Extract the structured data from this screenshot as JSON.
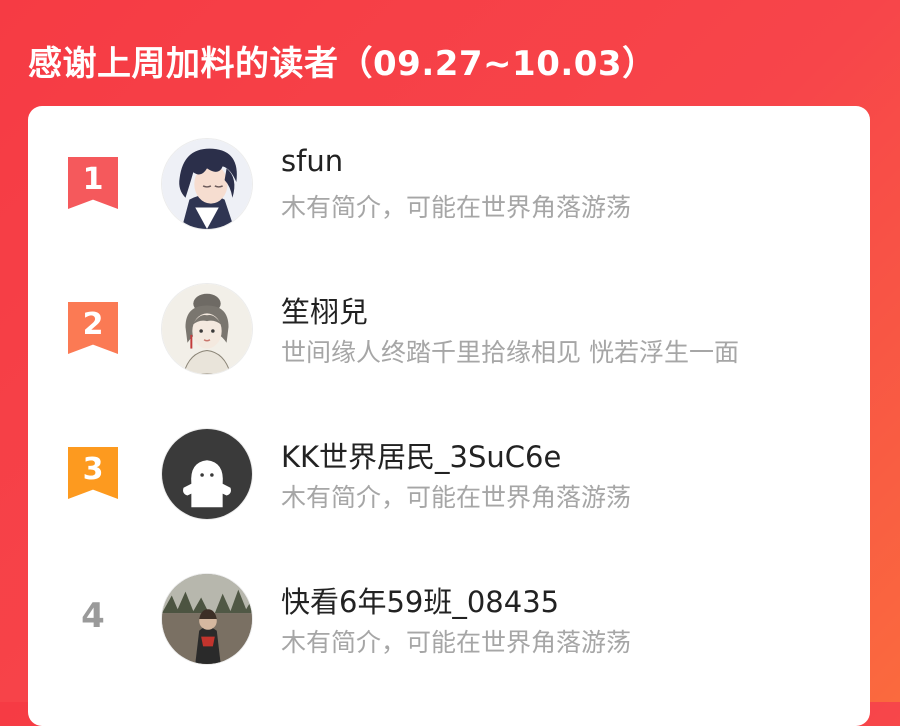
{
  "header": {
    "title": "感谢上周加料的读者（09.27~10.03）"
  },
  "readers": [
    {
      "rank": "1",
      "name": "sfun",
      "bio": "木有简介，可能在世界角落游荡",
      "avatar_icon": "anime-boy-avatar"
    },
    {
      "rank": "2",
      "name": "笙栩兒",
      "bio": "世间缘人终踏千里拾缘相见 恍若浮生一面",
      "avatar_icon": "ink-portrait-avatar"
    },
    {
      "rank": "3",
      "name": "KK世界居民_3SuC6e",
      "bio": "木有简介，可能在世界角落游荡",
      "avatar_icon": "default-ghost-avatar"
    },
    {
      "rank": "4",
      "name": "快看6年59班_08435",
      "bio": "木有简介，可能在世界角落游荡",
      "avatar_icon": "outdoor-photo-avatar"
    }
  ],
  "colors": {
    "background_start": "#f63b44",
    "background_end": "#fa6a3e",
    "rank1": "#f5595c",
    "rank2": "#fb7a54",
    "rank3": "#fd9a1f",
    "rank_plain": "#9a9a9a",
    "bio_text": "#a6a6a6"
  }
}
